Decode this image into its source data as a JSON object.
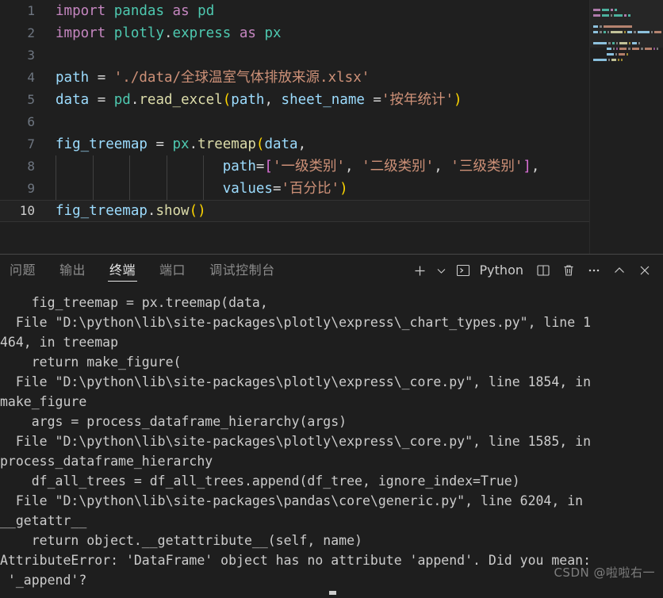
{
  "editor": {
    "lines": [
      {
        "num": "1",
        "tokens": [
          {
            "t": "import",
            "c": "kw"
          },
          {
            "t": " ",
            "c": "plain"
          },
          {
            "t": "pandas",
            "c": "mod"
          },
          {
            "t": " ",
            "c": "plain"
          },
          {
            "t": "as",
            "c": "kw"
          },
          {
            "t": " ",
            "c": "plain"
          },
          {
            "t": "pd",
            "c": "mod"
          }
        ]
      },
      {
        "num": "2",
        "tokens": [
          {
            "t": "import",
            "c": "kw"
          },
          {
            "t": " ",
            "c": "plain"
          },
          {
            "t": "plotly",
            "c": "mod"
          },
          {
            "t": ".",
            "c": "plain"
          },
          {
            "t": "express",
            "c": "mod"
          },
          {
            "t": " ",
            "c": "plain"
          },
          {
            "t": "as",
            "c": "kw"
          },
          {
            "t": " ",
            "c": "plain"
          },
          {
            "t": "px",
            "c": "mod"
          }
        ]
      },
      {
        "num": "3",
        "tokens": []
      },
      {
        "num": "4",
        "tokens": [
          {
            "t": "path",
            "c": "var"
          },
          {
            "t": " = ",
            "c": "op"
          },
          {
            "t": "'./data/全球温室气体排放来源.xlsx'",
            "c": "str"
          }
        ]
      },
      {
        "num": "5",
        "tokens": [
          {
            "t": "data",
            "c": "var"
          },
          {
            "t": " = ",
            "c": "op"
          },
          {
            "t": "pd",
            "c": "mod"
          },
          {
            "t": ".",
            "c": "plain"
          },
          {
            "t": "read_excel",
            "c": "fn"
          },
          {
            "t": "(",
            "c": "pr1"
          },
          {
            "t": "path",
            "c": "var"
          },
          {
            "t": ", ",
            "c": "op"
          },
          {
            "t": "sheet_name",
            "c": "var"
          },
          {
            "t": " =",
            "c": "op"
          },
          {
            "t": "'按年统计'",
            "c": "str"
          },
          {
            "t": ")",
            "c": "pr1"
          }
        ]
      },
      {
        "num": "6",
        "tokens": []
      },
      {
        "num": "7",
        "tokens": [
          {
            "t": "fig_treemap",
            "c": "var"
          },
          {
            "t": " = ",
            "c": "op"
          },
          {
            "t": "px",
            "c": "mod"
          },
          {
            "t": ".",
            "c": "plain"
          },
          {
            "t": "treemap",
            "c": "fn"
          },
          {
            "t": "(",
            "c": "pr1"
          },
          {
            "t": "data",
            "c": "var"
          },
          {
            "t": ",",
            "c": "op"
          }
        ]
      },
      {
        "num": "8",
        "tokens": [
          {
            "t": "                    ",
            "c": "plain"
          },
          {
            "t": "path",
            "c": "var"
          },
          {
            "t": "=",
            "c": "op"
          },
          {
            "t": "[",
            "c": "pr2"
          },
          {
            "t": "'一级类别'",
            "c": "str"
          },
          {
            "t": ", ",
            "c": "op"
          },
          {
            "t": "'二级类别'",
            "c": "str"
          },
          {
            "t": ", ",
            "c": "op"
          },
          {
            "t": "'三级类别'",
            "c": "str"
          },
          {
            "t": "]",
            "c": "pr2"
          },
          {
            "t": ",",
            "c": "op"
          }
        ]
      },
      {
        "num": "9",
        "tokens": [
          {
            "t": "                    ",
            "c": "plain"
          },
          {
            "t": "values",
            "c": "var"
          },
          {
            "t": "=",
            "c": "op"
          },
          {
            "t": "'百分比'",
            "c": "str"
          },
          {
            "t": ")",
            "c": "pr1"
          }
        ]
      },
      {
        "num": "10",
        "tokens": [
          {
            "t": "fig_treemap",
            "c": "var"
          },
          {
            "t": ".",
            "c": "plain"
          },
          {
            "t": "show",
            "c": "fn"
          },
          {
            "t": "(",
            "c": "pr1"
          },
          {
            "t": ")",
            "c": "pr1"
          }
        ],
        "active": true
      }
    ],
    "indent_guide_lines": [
      8,
      9
    ]
  },
  "panel": {
    "tabs": [
      {
        "label": "问题",
        "active": false
      },
      {
        "label": "输出",
        "active": false
      },
      {
        "label": "终端",
        "active": true
      },
      {
        "label": "端口",
        "active": false
      },
      {
        "label": "调试控制台",
        "active": false
      }
    ],
    "actions": {
      "new_terminal_label": "+",
      "new_terminal_icon": "plus-icon",
      "dropdown_icon": "chevron-down-icon",
      "terminal_kind_icon": "terminal-prompt-icon",
      "terminal_name": "Python",
      "split_icon": "split-editor-icon",
      "kill_icon": "trash-icon",
      "more_icon": "ellipsis-icon",
      "maximize_icon": "chevron-up-icon",
      "close_icon": "close-icon"
    }
  },
  "terminal": {
    "lines": [
      "    fig_treemap = px.treemap(data,",
      "  File \"D:\\python\\lib\\site-packages\\plotly\\express\\_chart_types.py\", line 1",
      "464, in treemap",
      "    return make_figure(",
      "  File \"D:\\python\\lib\\site-packages\\plotly\\express\\_core.py\", line 1854, in",
      "make_figure",
      "    args = process_dataframe_hierarchy(args)",
      "  File \"D:\\python\\lib\\site-packages\\plotly\\express\\_core.py\", line 1585, in",
      "process_dataframe_hierarchy",
      "    df_all_trees = df_all_trees.append(df_tree, ignore_index=True)",
      "  File \"D:\\python\\lib\\site-packages\\pandas\\core\\generic.py\", line 6204, in",
      "__getattr__",
      "    return object.__getattribute__(self, name)",
      "AttributeError: 'DataFrame' object has no attribute 'append'. Did you mean:",
      " '_append'?"
    ]
  },
  "watermark": {
    "text": "CSDN @啦啦右一"
  },
  "colors": {
    "editor_background": "#1f1f1f",
    "panel_background": "#1e1e1e",
    "keyword": "#c586c0",
    "module": "#4ec9b0",
    "variable": "#9cdcfe",
    "function": "#dcdcaa",
    "string": "#ce9178",
    "paren_yellow": "#ffd700",
    "bracket_pink": "#da70d6",
    "terminal_text": "#cccccc",
    "line_number": "#6e7681",
    "active_tab": "#e7e7e7"
  }
}
